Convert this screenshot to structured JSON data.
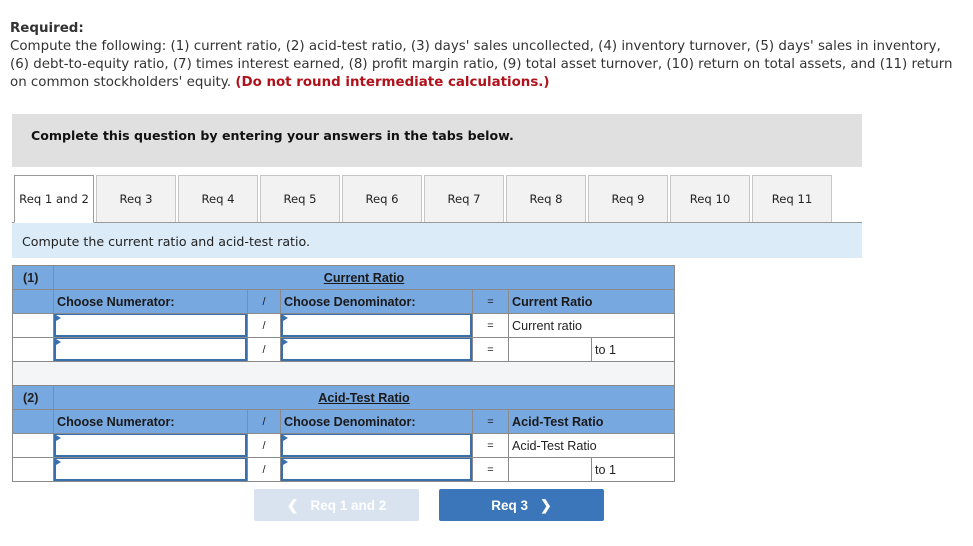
{
  "required": {
    "title": "Required:",
    "text": "Compute the following: (1) current ratio, (2) acid-test ratio, (3) days' sales uncollected, (4) inventory turnover, (5) days' sales in inventory, (6) debt-to-equity ratio, (7) times interest earned, (8) profit margin ratio, (9) total asset turnover, (10) return on total assets, and (11) return on common stockholders' equity.",
    "note": "(Do not round intermediate calculations.)"
  },
  "banner": {
    "text": "Complete this question by entering your answers in the tabs below."
  },
  "tabs": [
    {
      "label": "Req 1 and 2",
      "active": true
    },
    {
      "label": "Req 3"
    },
    {
      "label": "Req 4"
    },
    {
      "label": "Req 5"
    },
    {
      "label": "Req 6"
    },
    {
      "label": "Req 7"
    },
    {
      "label": "Req 8"
    },
    {
      "label": "Req 9"
    },
    {
      "label": "Req 10"
    },
    {
      "label": "Req 11"
    }
  ],
  "instruction": "Compute the current ratio and acid-test ratio.",
  "sections": [
    {
      "number": "(1)",
      "title": "Current Ratio",
      "numerator_label": "Choose Numerator:",
      "divide": "/",
      "denominator_label": "Choose Denominator:",
      "equals": "=",
      "result_label": "Current Ratio",
      "row1_result": "Current ratio",
      "row2_suffix": "to 1",
      "row1_numerator": "",
      "row1_denominator": "",
      "row2_numerator": "",
      "row2_denominator": "",
      "row2_value": ""
    },
    {
      "number": "(2)",
      "title": "Acid-Test Ratio",
      "numerator_label": "Choose Numerator:",
      "divide": "/",
      "denominator_label": "Choose Denominator:",
      "equals": "=",
      "result_label": "Acid-Test Ratio",
      "row1_result": "Acid-Test Ratio",
      "row2_suffix": "to 1",
      "row1_numerator": "",
      "row1_denominator": "",
      "row2_numerator": "",
      "row2_denominator": "",
      "row2_value": ""
    }
  ],
  "nav": {
    "prev_label": "Req 1 and 2",
    "next_label": "Req 3",
    "prev_icon": "chevron-left-icon",
    "next_icon": "chevron-right-icon"
  },
  "colors": {
    "header_blue": "#78a8e0",
    "next_button": "#3a76b9",
    "prev_button_disabled": "#d9e3f0",
    "note_red": "#b0121b",
    "instruction_bg": "#dbebf8"
  }
}
